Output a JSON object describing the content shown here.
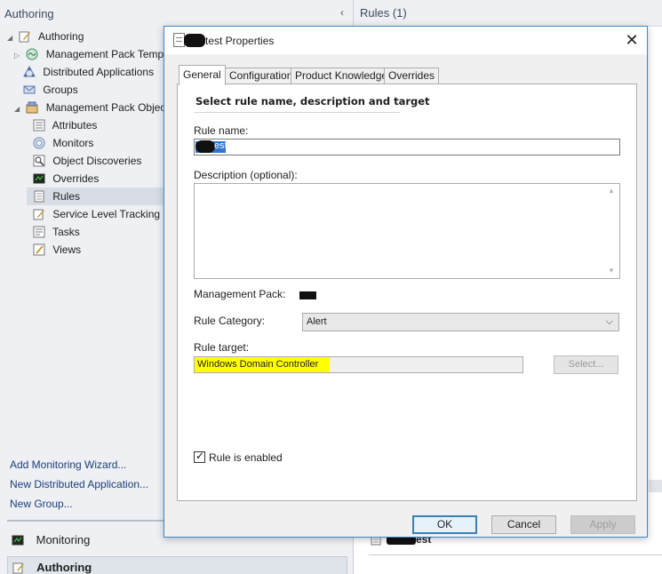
{
  "nav": {
    "header": "Authoring",
    "tree": [
      {
        "label": "Authoring",
        "icon": "authoring-icon",
        "expanded": true
      },
      {
        "label": "Management Pack Templat",
        "icon": "template-icon",
        "expanded": false
      },
      {
        "label": "Distributed Applications",
        "icon": "distributed-apps-icon"
      },
      {
        "label": "Groups",
        "icon": "groups-icon"
      },
      {
        "label": "Management Pack Objects",
        "icon": "mp-objects-icon",
        "expanded": true
      },
      {
        "label": "Attributes",
        "icon": "attributes-icon"
      },
      {
        "label": "Monitors",
        "icon": "monitors-icon"
      },
      {
        "label": "Object Discoveries",
        "icon": "discoveries-icon"
      },
      {
        "label": "Overrides",
        "icon": "overrides-icon"
      },
      {
        "label": "Rules",
        "icon": "rules-icon",
        "selected": true
      },
      {
        "label": "Service Level Tracking",
        "icon": "slt-icon"
      },
      {
        "label": "Tasks",
        "icon": "tasks-icon"
      },
      {
        "label": "Views",
        "icon": "views-icon"
      }
    ],
    "links": [
      "Add Monitoring Wizard...",
      "New Distributed Application...",
      "New Group..."
    ],
    "wunderbar": {
      "monitoring": "Monitoring",
      "authoring": "Authoring"
    }
  },
  "right": {
    "header": "Rules (1)",
    "row_suffix": "est"
  },
  "dialog": {
    "title_suffix": "test Properties",
    "tabs": [
      "General",
      "Configuration",
      "Product Knowledge",
      "Overrides"
    ],
    "active_tab": "General",
    "panel_header": "Select rule name, description and target",
    "rule_name_label": "Rule name:",
    "rule_name_value_suffix": "est",
    "description_label": "Description (optional):",
    "description_value": "",
    "mp_label": "Management Pack:",
    "category_label": "Rule Category:",
    "category_value": "Alert",
    "target_label": "Rule target:",
    "target_value": "Windows Domain Controller",
    "select_button": "Select...",
    "enabled_label": "Rule is enabled",
    "enabled": true,
    "buttons": {
      "ok": "OK",
      "cancel": "Cancel",
      "apply": "Apply"
    }
  },
  "colors": {
    "accent": "#3c7fb1",
    "highlight": "#ffff00",
    "selection": "#3075d0"
  }
}
